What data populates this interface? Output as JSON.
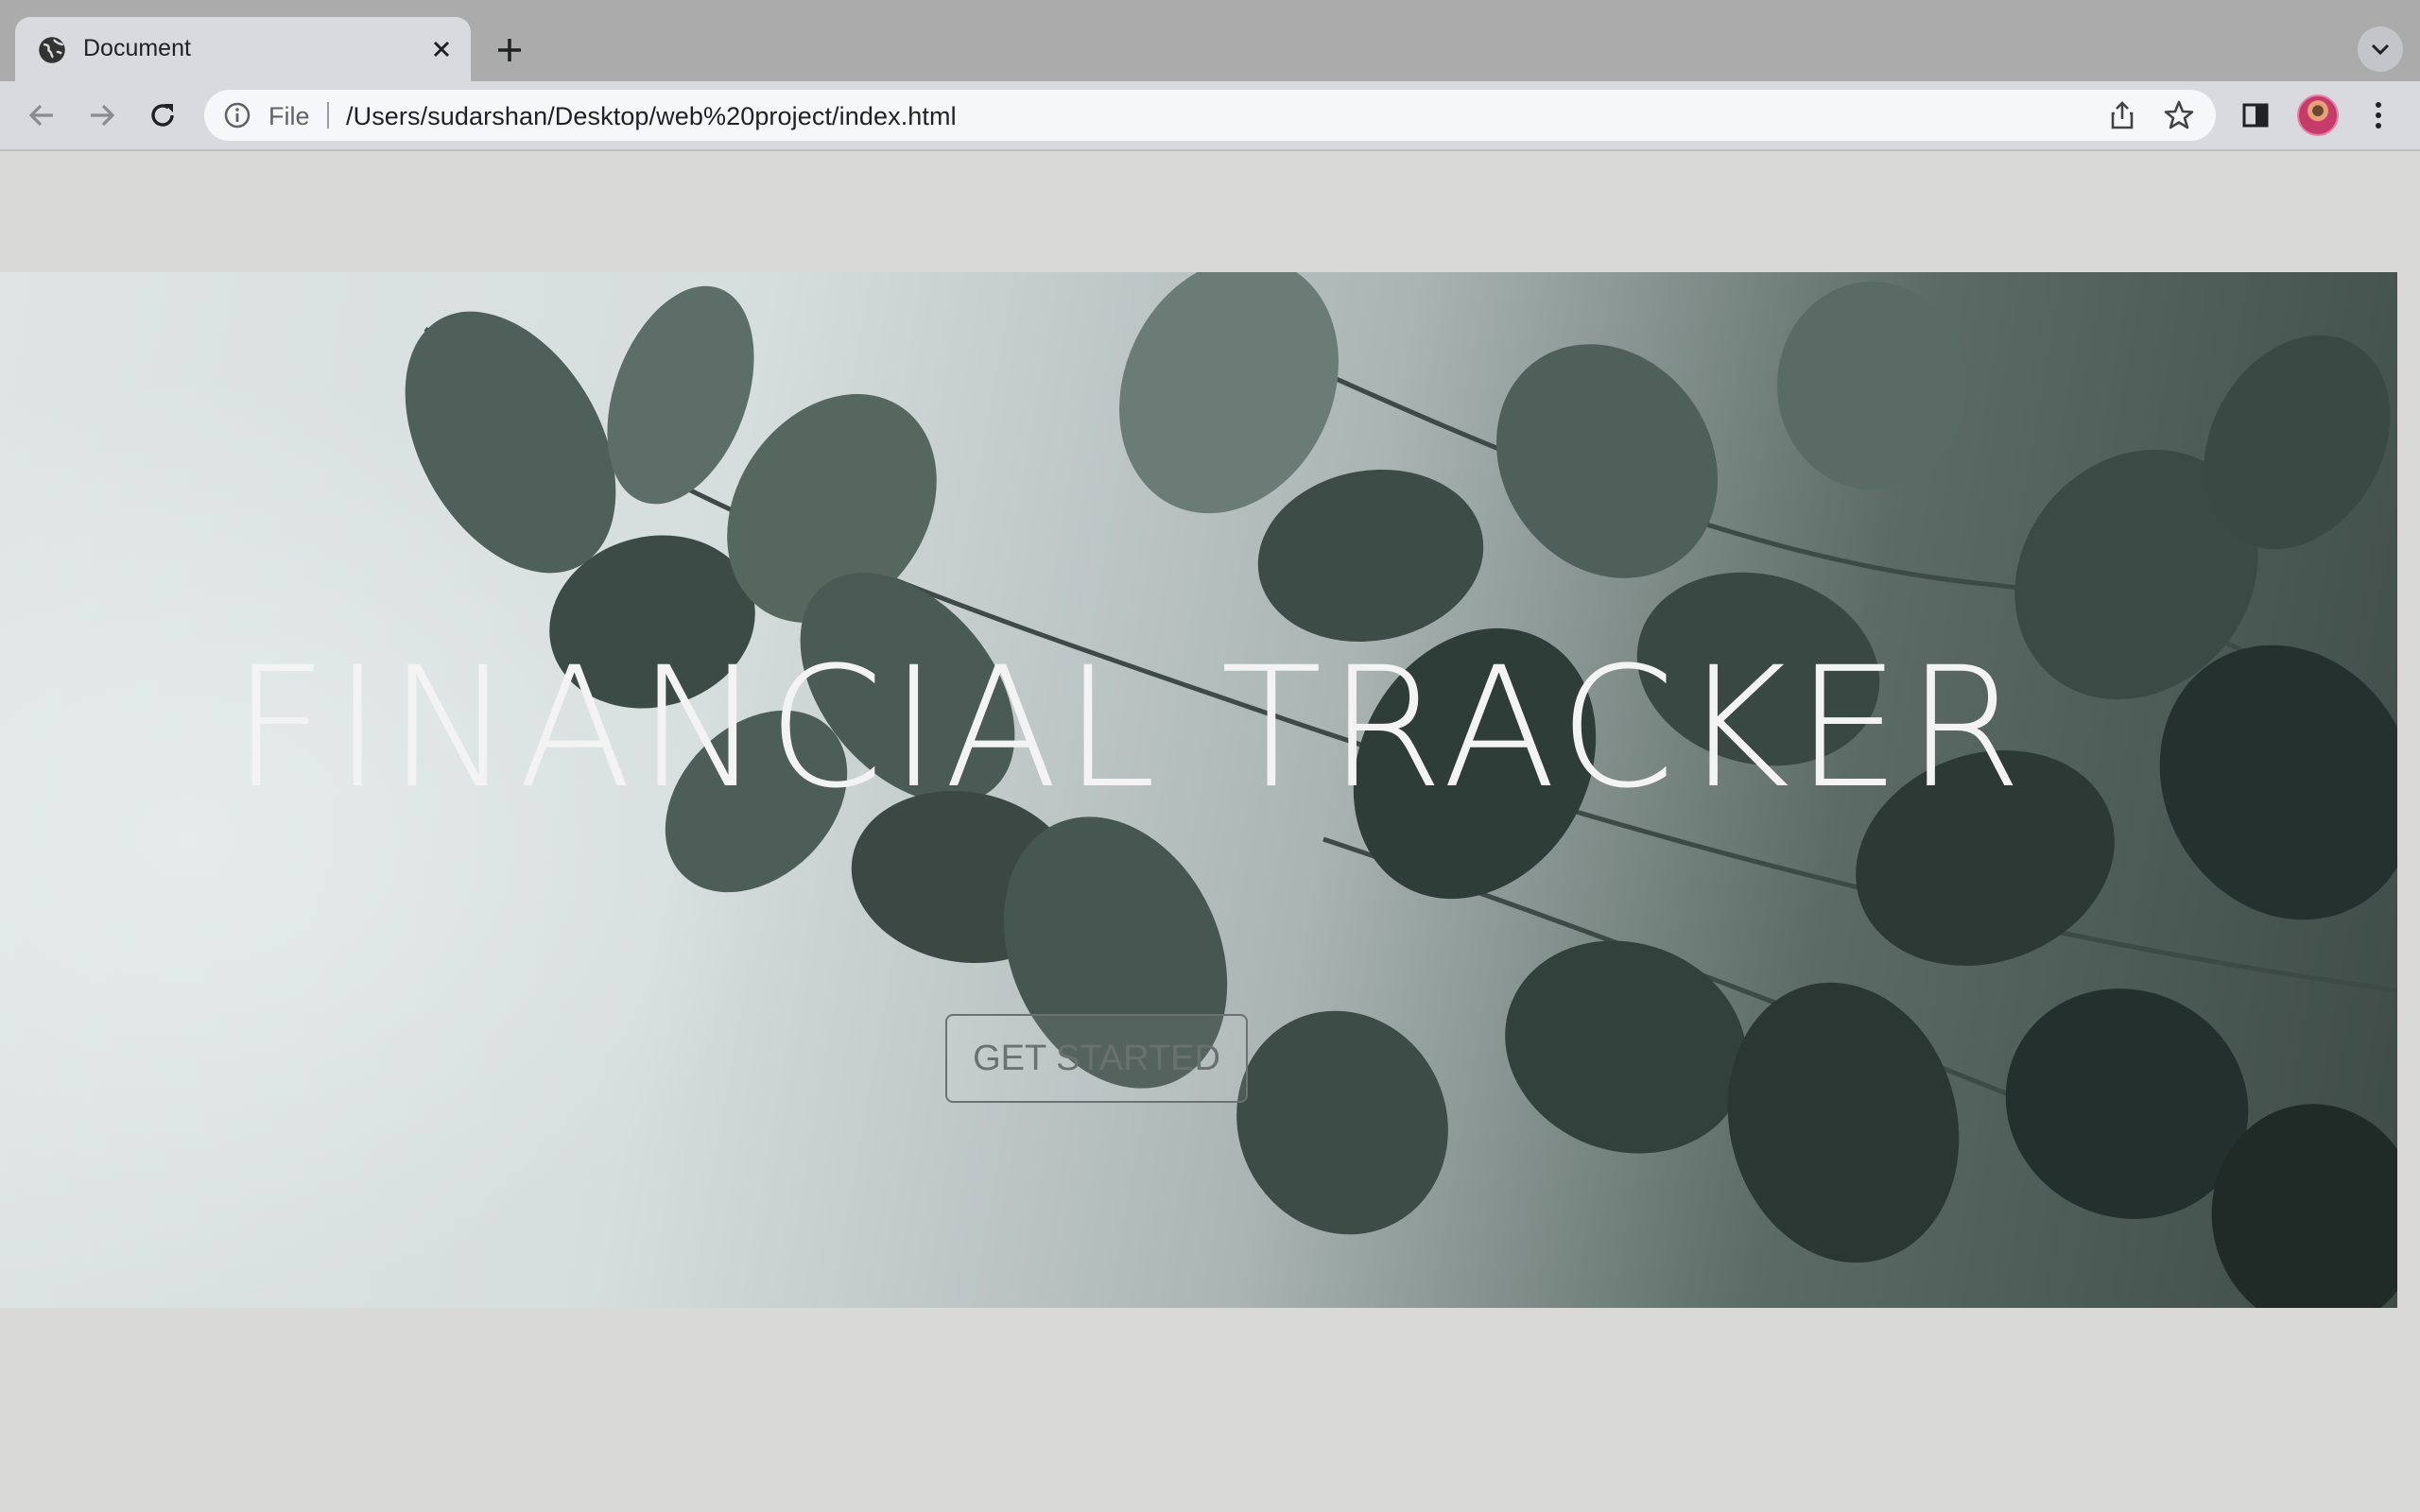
{
  "browser": {
    "tab": {
      "title": "Document"
    },
    "omnibox": {
      "scheme_label": "File",
      "url": "/Users/sudarshan/Desktop/web%20project/index.html"
    },
    "icons": {
      "tab_favicon": "globe-icon",
      "tab_close": "close-icon",
      "new_tab": "plus-icon",
      "tab_list": "chevron-down-icon",
      "back": "back-arrow-icon",
      "forward": "forward-arrow-icon",
      "reload": "reload-icon",
      "site_info": "info-icon",
      "share": "share-icon",
      "bookmark": "star-icon",
      "side_panel": "side-panel-icon",
      "menu": "kebab-menu-icon"
    }
  },
  "page": {
    "hero_title": "FINANCIAL TRACKER",
    "cta_label": "GET STARTED"
  },
  "colors": {
    "page_background": "#d9d9d7",
    "title_color": "#f3f3f3",
    "leaf_dark": "#2f3d39",
    "leaf_mid": "#5a6b66"
  }
}
